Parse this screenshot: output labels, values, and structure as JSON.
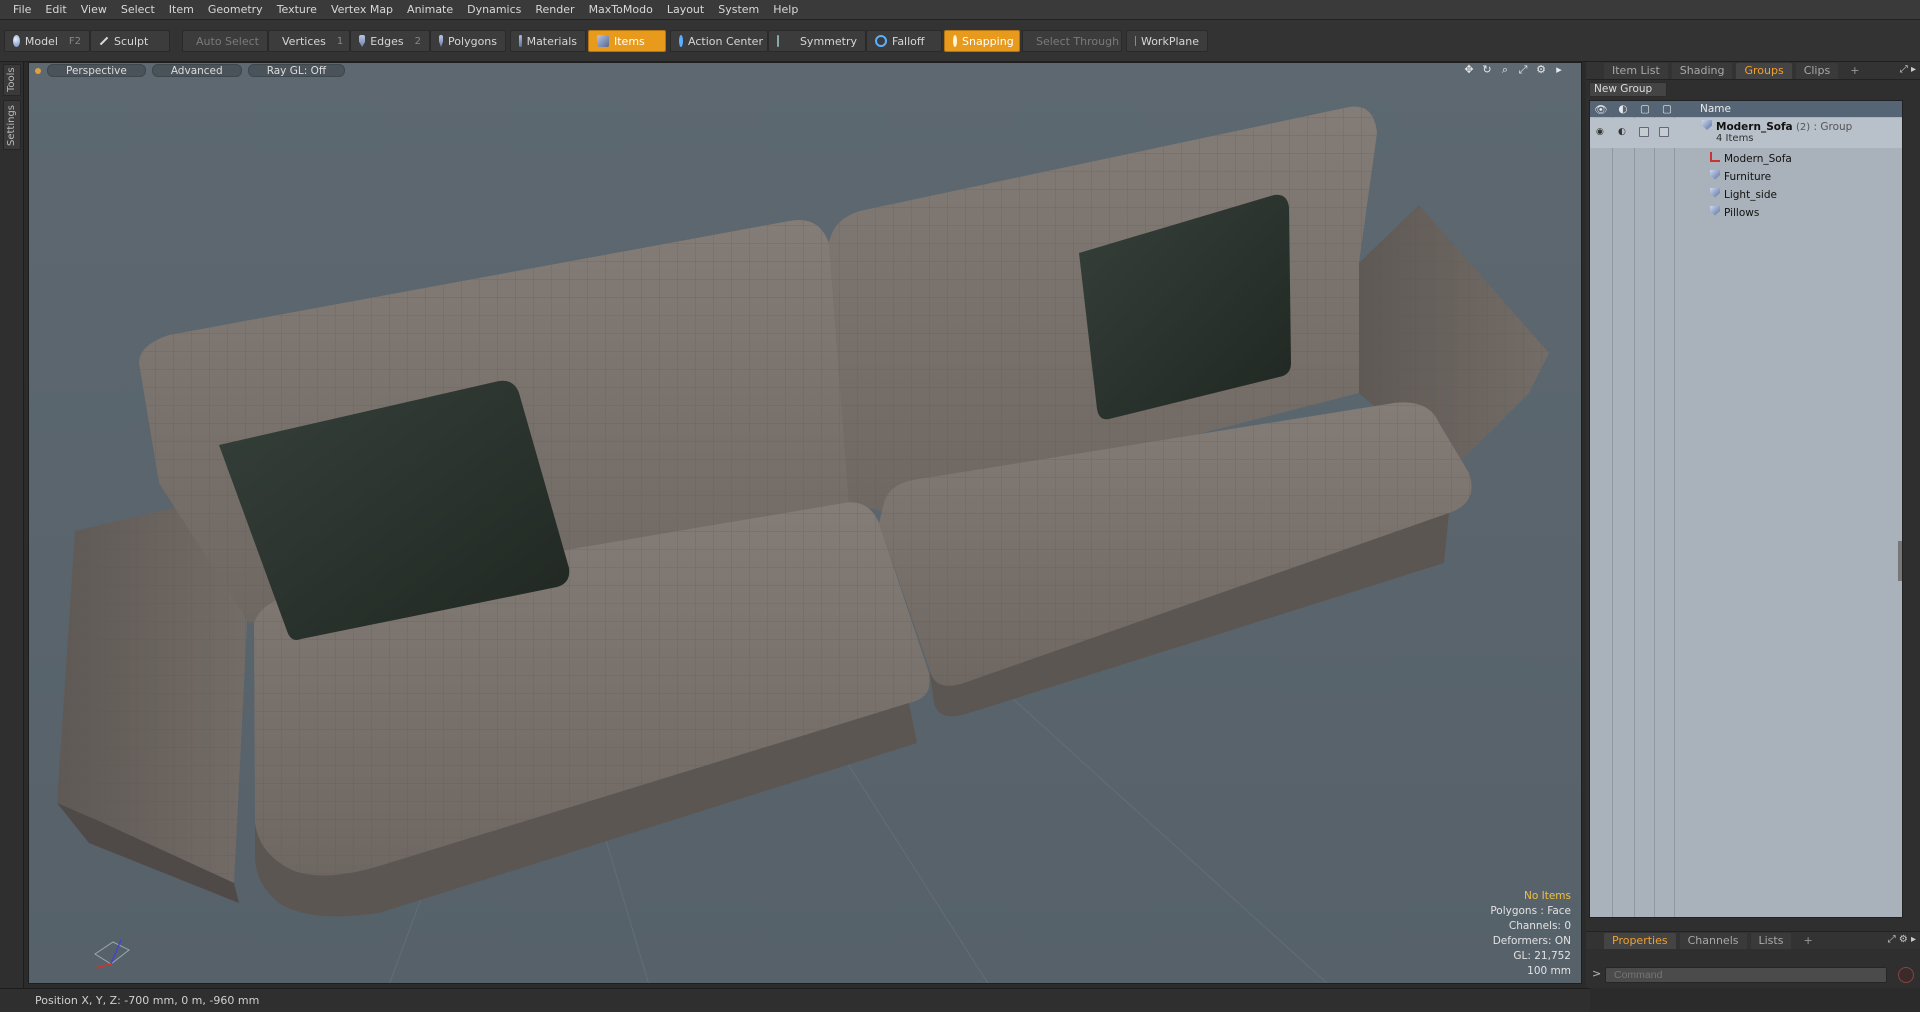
{
  "menu": [
    "File",
    "Edit",
    "View",
    "Select",
    "Item",
    "Geometry",
    "Texture",
    "Vertex Map",
    "Animate",
    "Dynamics",
    "Render",
    "MaxToModo",
    "Layout",
    "System",
    "Help"
  ],
  "toolbar": {
    "model": "Model",
    "model_key": "F2",
    "sculpt": "Sculpt",
    "auto_select": "Auto Select",
    "vertices": "Vertices",
    "vertices_key": "1",
    "edges": "Edges",
    "edges_key": "2",
    "polygons": "Polygons",
    "materials": "Materials",
    "items": "Items",
    "action_center": "Action Center",
    "symmetry": "Symmetry",
    "falloff": "Falloff",
    "snapping": "Snapping",
    "select_through": "Select Through",
    "workplane": "WorkPlane"
  },
  "left_tabs": [
    "Tools",
    "Settings"
  ],
  "viewport": {
    "perspective": "Perspective",
    "advanced": "Advanced",
    "raygl": "Ray GL: Off",
    "hud": {
      "no_items": "No Items",
      "polygons": "Polygons : Face",
      "channels": "Channels: 0",
      "deformers": "Deformers: ON",
      "gl": "GL: 21,752",
      "scale": "100 mm"
    }
  },
  "status": "Position X, Y, Z:  -700 mm, 0 m, -960 mm",
  "panel": {
    "tabs": [
      "Item List",
      "Shading",
      "Groups",
      "Clips"
    ],
    "active_tab": "Groups",
    "new_group": "New Group",
    "name_header": "Name",
    "group": {
      "name": "Modern_Sofa",
      "count": "(2)",
      "type": ": Group",
      "items_label": "4 Items"
    },
    "children": [
      "Modern_Sofa",
      "Furniture",
      "Light_side",
      "Pillows"
    ],
    "bottom_tabs": [
      "Properties",
      "Channels",
      "Lists"
    ],
    "active_bottom": "Properties",
    "command_placeholder": "Command"
  },
  "colors": {
    "accent": "#e89a1c",
    "viewport_bg": "#5b666e",
    "sofa": "#7a726c",
    "pillow": "#2c342d"
  }
}
